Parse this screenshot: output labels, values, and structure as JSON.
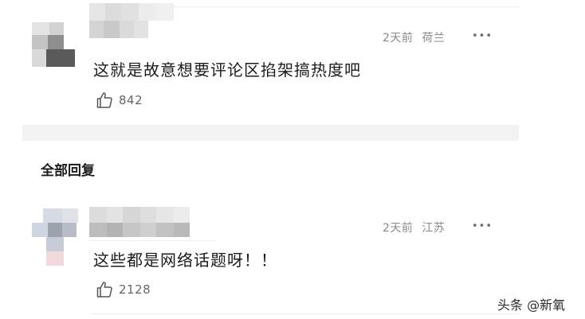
{
  "comments": [
    {
      "meta_time": "2天前",
      "meta_location": "荷兰",
      "more": "•••",
      "content": "这就是故意想要评论区掐架搞热度吧",
      "likes": "842"
    },
    {
      "meta_time": "2天前",
      "meta_location": "江苏",
      "more": "•••",
      "content": "这些都是网络话题呀！！",
      "likes": "2128"
    }
  ],
  "section_title": "全部回复",
  "watermark": "头条 @新氧",
  "icons": {
    "like": "thumbs-up-icon",
    "more": "more-dots-icon"
  },
  "colors": {
    "meta": "#8a8a8a",
    "content": "#1c1c1c",
    "divider": "#f3f3f3"
  }
}
